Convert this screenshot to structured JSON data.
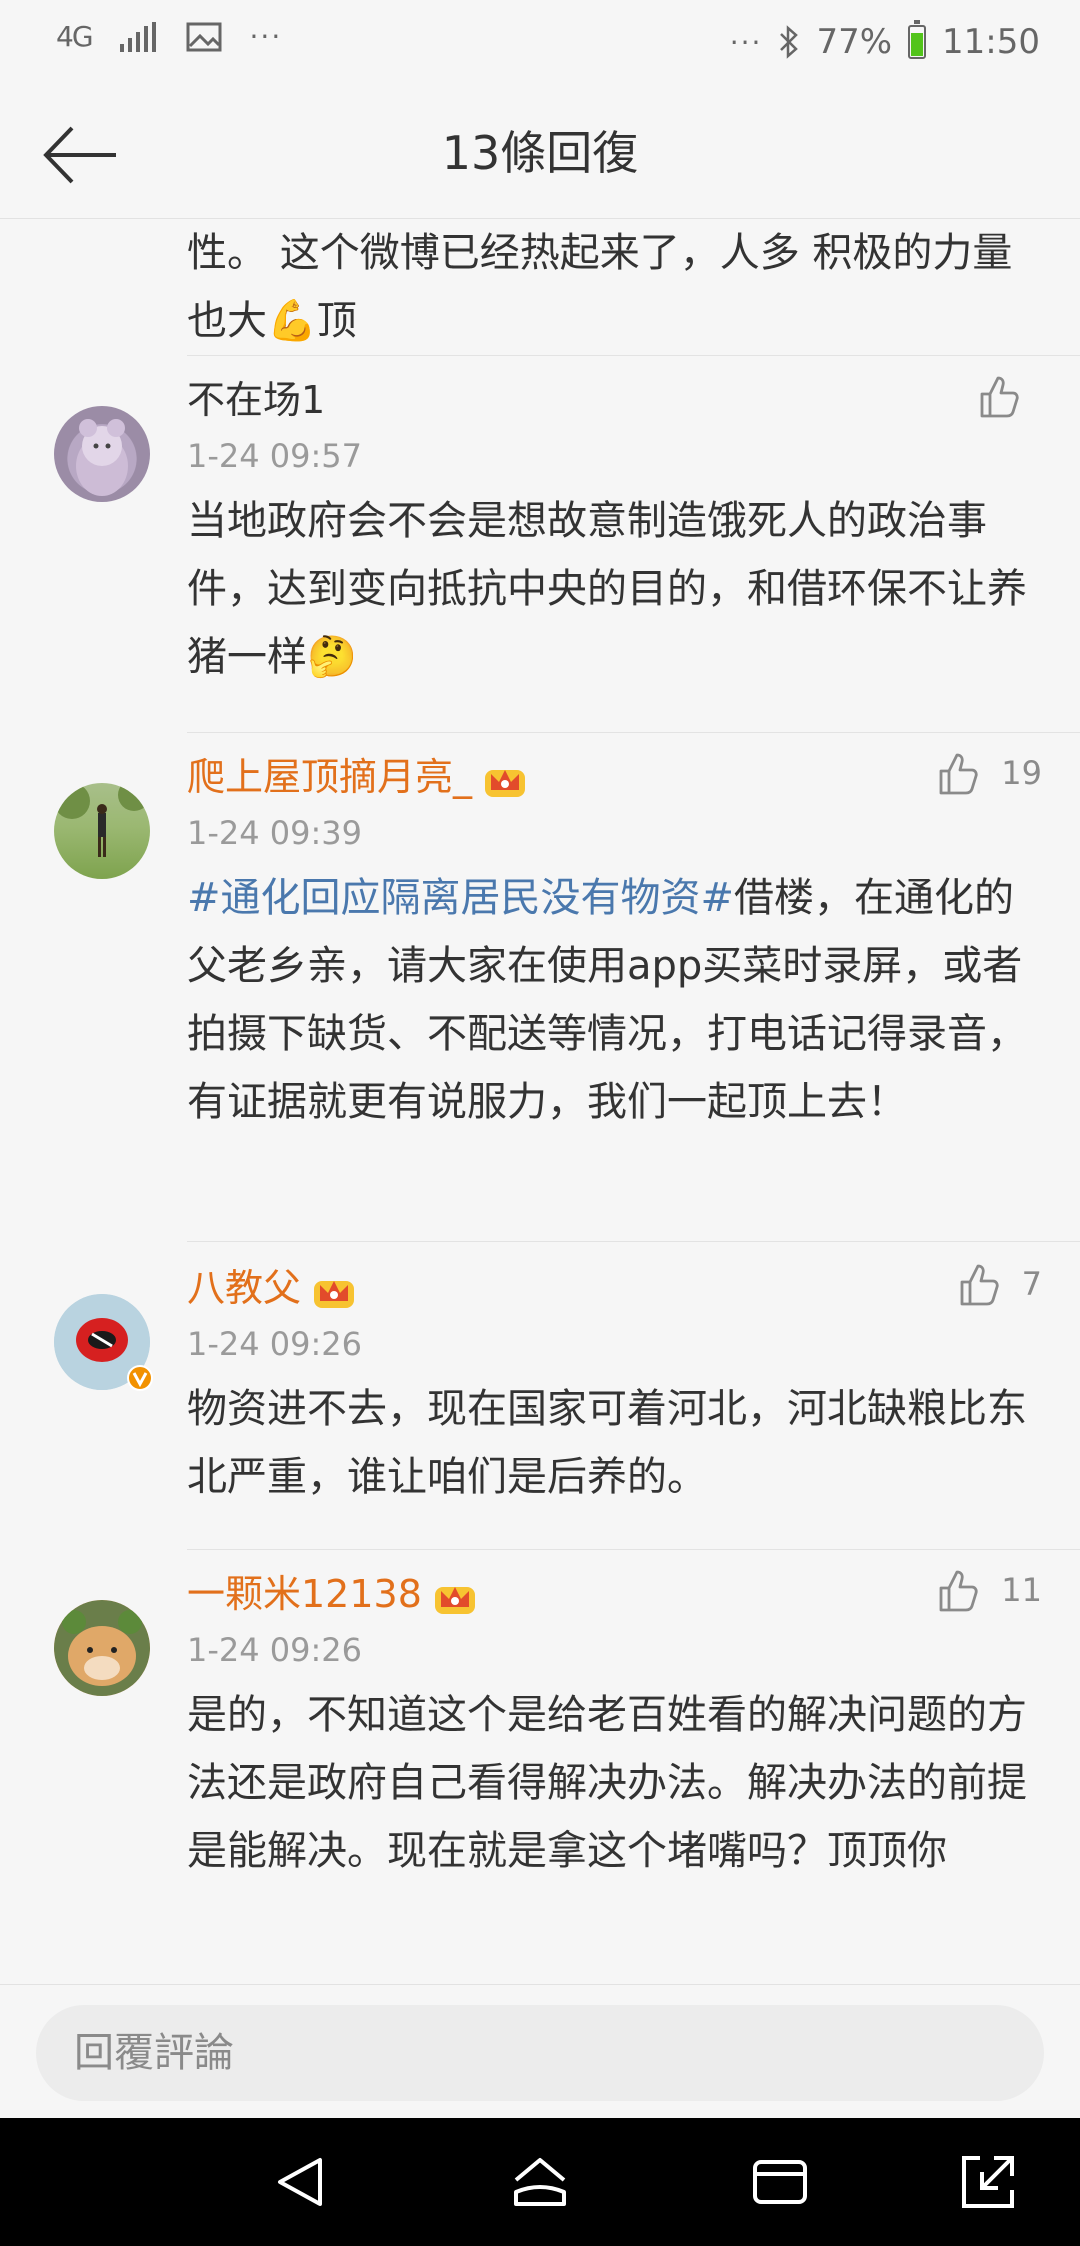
{
  "status_bar": {
    "network": "4G",
    "more_left": "···",
    "more_right": "···",
    "battery": "77%",
    "time": "11:50"
  },
  "header": {
    "title": "13條回復"
  },
  "continued_text": "性。 这个微博已经热起来了，人多 积极的力量也大💪顶",
  "comments": [
    {
      "name": "不在场1",
      "time": "1-24 09:57",
      "likes": "",
      "text": "当地政府会不会是想故意制造饿死人的政治事件，达到变向抵抗中央的目的，和借环保不让养猪一样🤔"
    },
    {
      "name": "爬上屋顶摘月亮_",
      "time": "1-24 09:39",
      "likes": "19",
      "hashtag": "#通化回应隔离居民没有物资#",
      "text": "借楼，在通化的父老乡亲，请大家在使用app买菜时录屏，或者拍摄下缺货、不配送等情况，打电话记得录音，有证据就更有说服力，我们一起顶上去！"
    },
    {
      "name": "八教父",
      "time": "1-24 09:26",
      "likes": "7",
      "text": "物资进不去，现在国家可着河北，河北缺粮比东北严重，谁让咱们是后养的。"
    },
    {
      "name": "一颗米12138",
      "time": "1-24 09:26",
      "likes": "11",
      "text": "是的，不知道这个是给老百姓看的解决问题的方法还是政府自己看得解决办法。解决办法的前提是能解决。现在就是拿这个堵嘴吗？顶顶你"
    }
  ],
  "reply_bar": {
    "placeholder": "回覆評論"
  },
  "colors": {
    "vip_name": "#e2701b",
    "hashtag": "#4a78ad",
    "time": "#9a9a9a"
  }
}
